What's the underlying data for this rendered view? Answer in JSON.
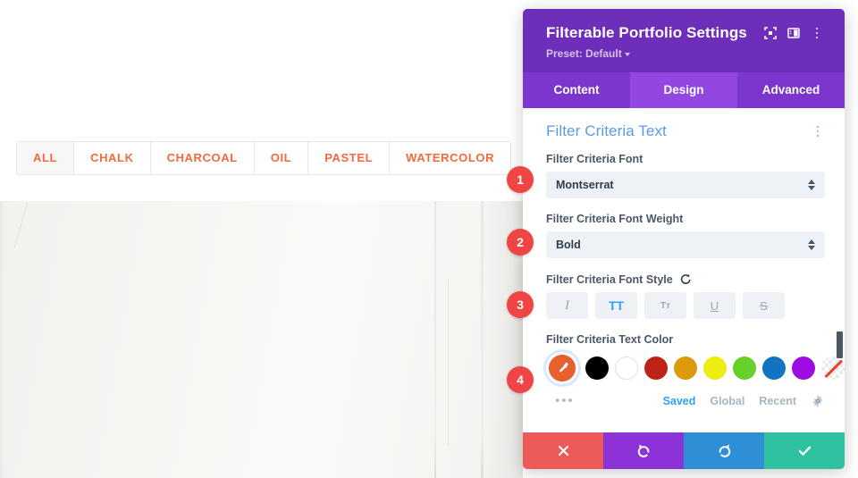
{
  "site_preview": {
    "filter_bar": {
      "name": "portfolio-filter-bar",
      "items": [
        {
          "label": "All",
          "active": true
        },
        {
          "label": "Chalk",
          "active": false
        },
        {
          "label": "Charcoal",
          "active": false
        },
        {
          "label": "Oil",
          "active": false
        },
        {
          "label": "Pastel",
          "active": false
        },
        {
          "label": "Watercolor",
          "active": false
        }
      ],
      "text_color": "#f4693d",
      "active_bg": "#f7f7f7"
    },
    "image_alt": "white-wall-photo"
  },
  "panel": {
    "title": "Filterable Portfolio Settings",
    "preset_label": "Preset: Default",
    "header_icons": [
      {
        "name": "focus-frame-icon"
      },
      {
        "name": "layout-split-icon"
      },
      {
        "name": "kebab-menu-icon"
      }
    ],
    "header_bg": "#6d2fba",
    "tabs": [
      {
        "label": "Content",
        "active": false
      },
      {
        "label": "Design",
        "active": true
      },
      {
        "label": "Advanced",
        "active": false
      }
    ],
    "section": {
      "title": "Filter Criteria Text",
      "title_color": "#5b9ae8"
    },
    "fields": {
      "font": {
        "label": "Filter Criteria Font",
        "value": "Montserrat"
      },
      "font_weight": {
        "label": "Filter Criteria Font Weight",
        "value": "Bold"
      },
      "font_style": {
        "label": "Filter Criteria Font Style",
        "has_reset": true,
        "buttons": [
          {
            "name": "italic",
            "glyph": "I",
            "active": false
          },
          {
            "name": "uppercase",
            "glyph": "TT",
            "active": true
          },
          {
            "name": "small-caps",
            "glyph": "Tт",
            "active": false
          },
          {
            "name": "underline",
            "glyph": "U",
            "active": false
          },
          {
            "name": "strikethrough",
            "glyph": "S",
            "active": false
          }
        ]
      },
      "text_color": {
        "label": "Filter Criteria Text Color",
        "selected_color": "#e8602c",
        "swatches": [
          {
            "name": "black",
            "hex": "#000000"
          },
          {
            "name": "white",
            "hex": "#ffffff"
          },
          {
            "name": "dark-red",
            "hex": "#bf2318"
          },
          {
            "name": "amber",
            "hex": "#dd9a0d"
          },
          {
            "name": "yellow",
            "hex": "#eded12"
          },
          {
            "name": "green",
            "hex": "#67d02a"
          },
          {
            "name": "blue",
            "hex": "#1173c2"
          },
          {
            "name": "purple",
            "hex": "#9d0ce0"
          },
          {
            "name": "transparent",
            "hex": "none"
          }
        ],
        "more_label": "•••",
        "tabs": [
          {
            "label": "Saved",
            "active": true
          },
          {
            "label": "Global",
            "active": false
          },
          {
            "label": "Recent",
            "active": false
          }
        ],
        "settings_icon": "gear-icon"
      }
    },
    "footer_actions": [
      {
        "name": "cancel-button",
        "icon": "close-icon",
        "color": "#ed5a5a"
      },
      {
        "name": "undo-button",
        "icon": "undo-icon",
        "color": "#8b33d6"
      },
      {
        "name": "redo-button",
        "icon": "redo-icon",
        "color": "#2e8fd6"
      },
      {
        "name": "save-button",
        "icon": "checkmark-icon",
        "color": "#2ec2a0"
      }
    ]
  },
  "callouts": [
    {
      "number": "1"
    },
    {
      "number": "2"
    },
    {
      "number": "3"
    },
    {
      "number": "4"
    }
  ]
}
